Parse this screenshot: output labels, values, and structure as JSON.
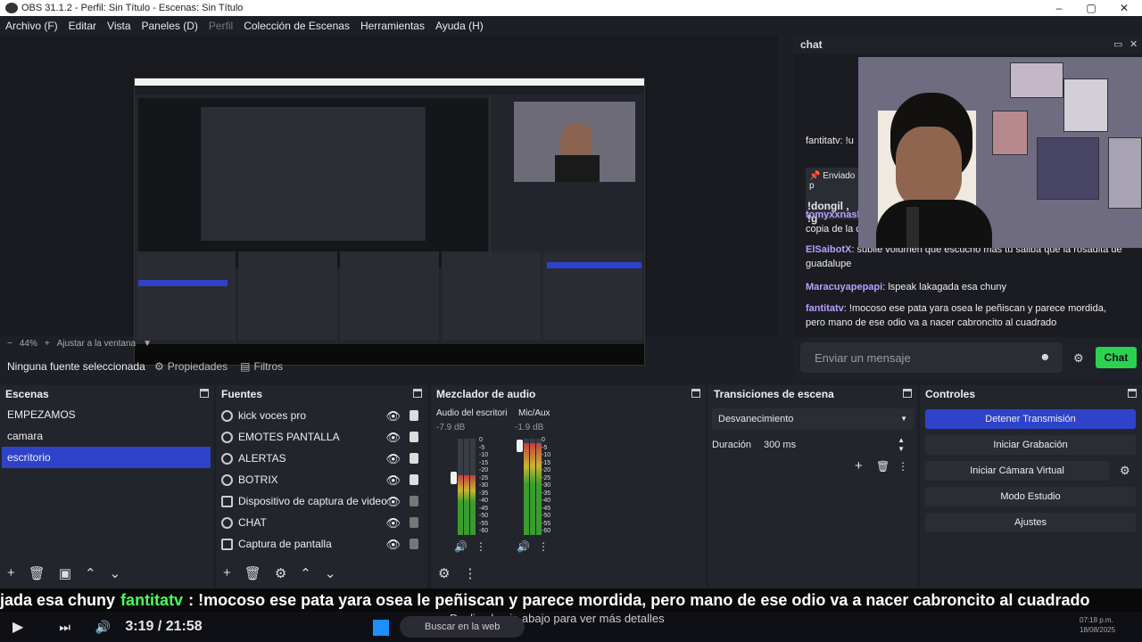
{
  "window": {
    "title": "OBS 31.1.2 - Perfil: Sin Título - Escenas: Sin Título"
  },
  "menu": [
    "Archivo (F)",
    "Editar",
    "Vista",
    "Paneles (D)",
    "Perfil",
    "Colección de Escenas",
    "Herramientas",
    "Ayuda (H)"
  ],
  "preview": {
    "zoom": "44%",
    "fit_label": "Ajustar a la ventana"
  },
  "source_bar": {
    "none_selected": "Ninguna fuente seleccionada",
    "properties": "Propiedades",
    "filters": "Filtros"
  },
  "chat": {
    "title": "chat",
    "pinned_label": "Enviado p",
    "pinned_text": "!dongil , !g",
    "messages": [
      {
        "user": "tomyxxnasl",
        "text": "copia de la c"
      },
      {
        "user": "ElSaibotX",
        "text": "subile volumen que escucho mas tu saliba que la rosadita de guadalupe"
      },
      {
        "user": "Maracuyapepapi",
        "text": "lspeak lakagada esa chuny"
      },
      {
        "user": "fantitatv",
        "text": "!mocoso ese pata yara osea le peñiscan y parece mordida, pero mano de ese odio va a nacer cabroncito al cuadrado"
      }
    ],
    "input_placeholder": "Enviar un mensaje",
    "send_label": "Chat",
    "partial_user": "fantitatv: !u"
  },
  "scenes": {
    "title": "Escenas",
    "items": [
      "EMPEZAMOS",
      "camara",
      "escritorio"
    ],
    "selected": 2
  },
  "sources": {
    "title": "Fuentes",
    "items": [
      {
        "name": "kick voces pro",
        "locked": true
      },
      {
        "name": "EMOTES PANTALLA",
        "locked": true
      },
      {
        "name": "ALERTAS",
        "locked": true
      },
      {
        "name": "BOTRIX",
        "locked": true
      },
      {
        "name": "Dispositivo de captura de video",
        "locked": false
      },
      {
        "name": "CHAT",
        "locked": false
      },
      {
        "name": "Captura de pantalla",
        "locked": false
      }
    ]
  },
  "mixer": {
    "title": "Mezclador de audio",
    "channels": [
      {
        "name": "Audio del escritorio",
        "db": "-7.9 dB",
        "level": 0.62
      },
      {
        "name": "Mic/Aux",
        "db": "-1.9 dB",
        "level": 0.95
      }
    ],
    "scale": [
      "0",
      "-5",
      "-10",
      "-15",
      "-20",
      "-25",
      "-30",
      "-35",
      "-40",
      "-45",
      "-50",
      "-55",
      "-60"
    ]
  },
  "transitions": {
    "title": "Transiciones de escena",
    "selected": "Desvanecimiento",
    "duration_label": "Duración",
    "duration": "300 ms"
  },
  "controls": {
    "title": "Controles",
    "buttons": [
      "Detener Transmisión",
      "Iniciar Grabación",
      "Iniciar Cámara Virtual",
      "Modo Estudio",
      "Ajustes"
    ]
  },
  "subtitle": {
    "prefix": "jada esa chuny",
    "user": "fantitatv",
    "text": ": !mocoso ese pata yara osea le peñiscan y parece mordida, pero mano de ese odio va a nacer cabroncito al cuadrado"
  },
  "player": {
    "time": "3:19 / 21:58",
    "overlay": "Desliza hacia abajo para ver más detalles"
  },
  "taskbar": {
    "search_placeholder": "Buscar en la web",
    "clock_time": "07:18 p.m.",
    "clock_date": "18/08/2025"
  },
  "colors": {
    "accent": "#2e43c9",
    "chat_green": "#2bd24f",
    "sub_green": "#46ff5a"
  }
}
